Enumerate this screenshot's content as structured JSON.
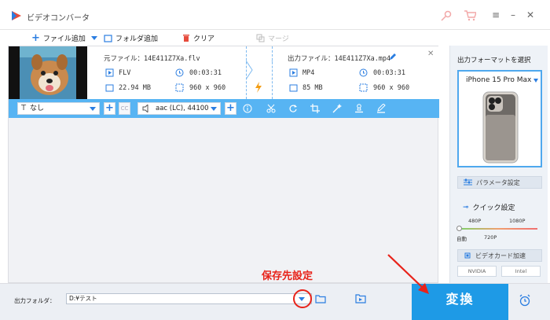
{
  "window": {
    "title": "ビデオコンバータ"
  },
  "toolbar": {
    "add_file": "ファイル追加",
    "add_folder": "フォルダ追加",
    "clear": "クリア",
    "merge": "マージ"
  },
  "file": {
    "source_label": "元ファイル：",
    "source_name": "14E411Z7Xa.flv",
    "output_label": "出力ファイル：",
    "output_name": "14E411Z7Xa.mp4",
    "src_format": "FLV",
    "src_duration": "00:03:31",
    "src_size": "22.94 MB",
    "src_resolution": "960 x 960",
    "out_format": "MP4",
    "out_duration": "00:03:31",
    "out_size": "85 MB",
    "out_resolution": "960 x 960"
  },
  "editbar": {
    "subtitle": "なし",
    "cc": "CC",
    "audio": "aac (LC), 44100"
  },
  "right_panel": {
    "title": "出力フォーマットを選択",
    "device": "iPhone 15 Pro Max",
    "param_button": "パラメータ設定",
    "quick_title": "クイック設定",
    "scale_top": [
      "480P",
      "1080P"
    ],
    "scale_bottom": [
      "自動",
      "720P"
    ],
    "gpu_button": "ビデオカード加速",
    "vendors": [
      "NVIDIA",
      "Intel"
    ]
  },
  "bottom": {
    "output_folder_label": "出力フォルダ：",
    "output_path": "D:¥テスト",
    "convert": "変換"
  },
  "annotation": {
    "text": "保存先設定"
  },
  "colors": {
    "accent": "#1e9ae6",
    "editbar": "#57b4f3",
    "annotation": "#e8231a"
  }
}
